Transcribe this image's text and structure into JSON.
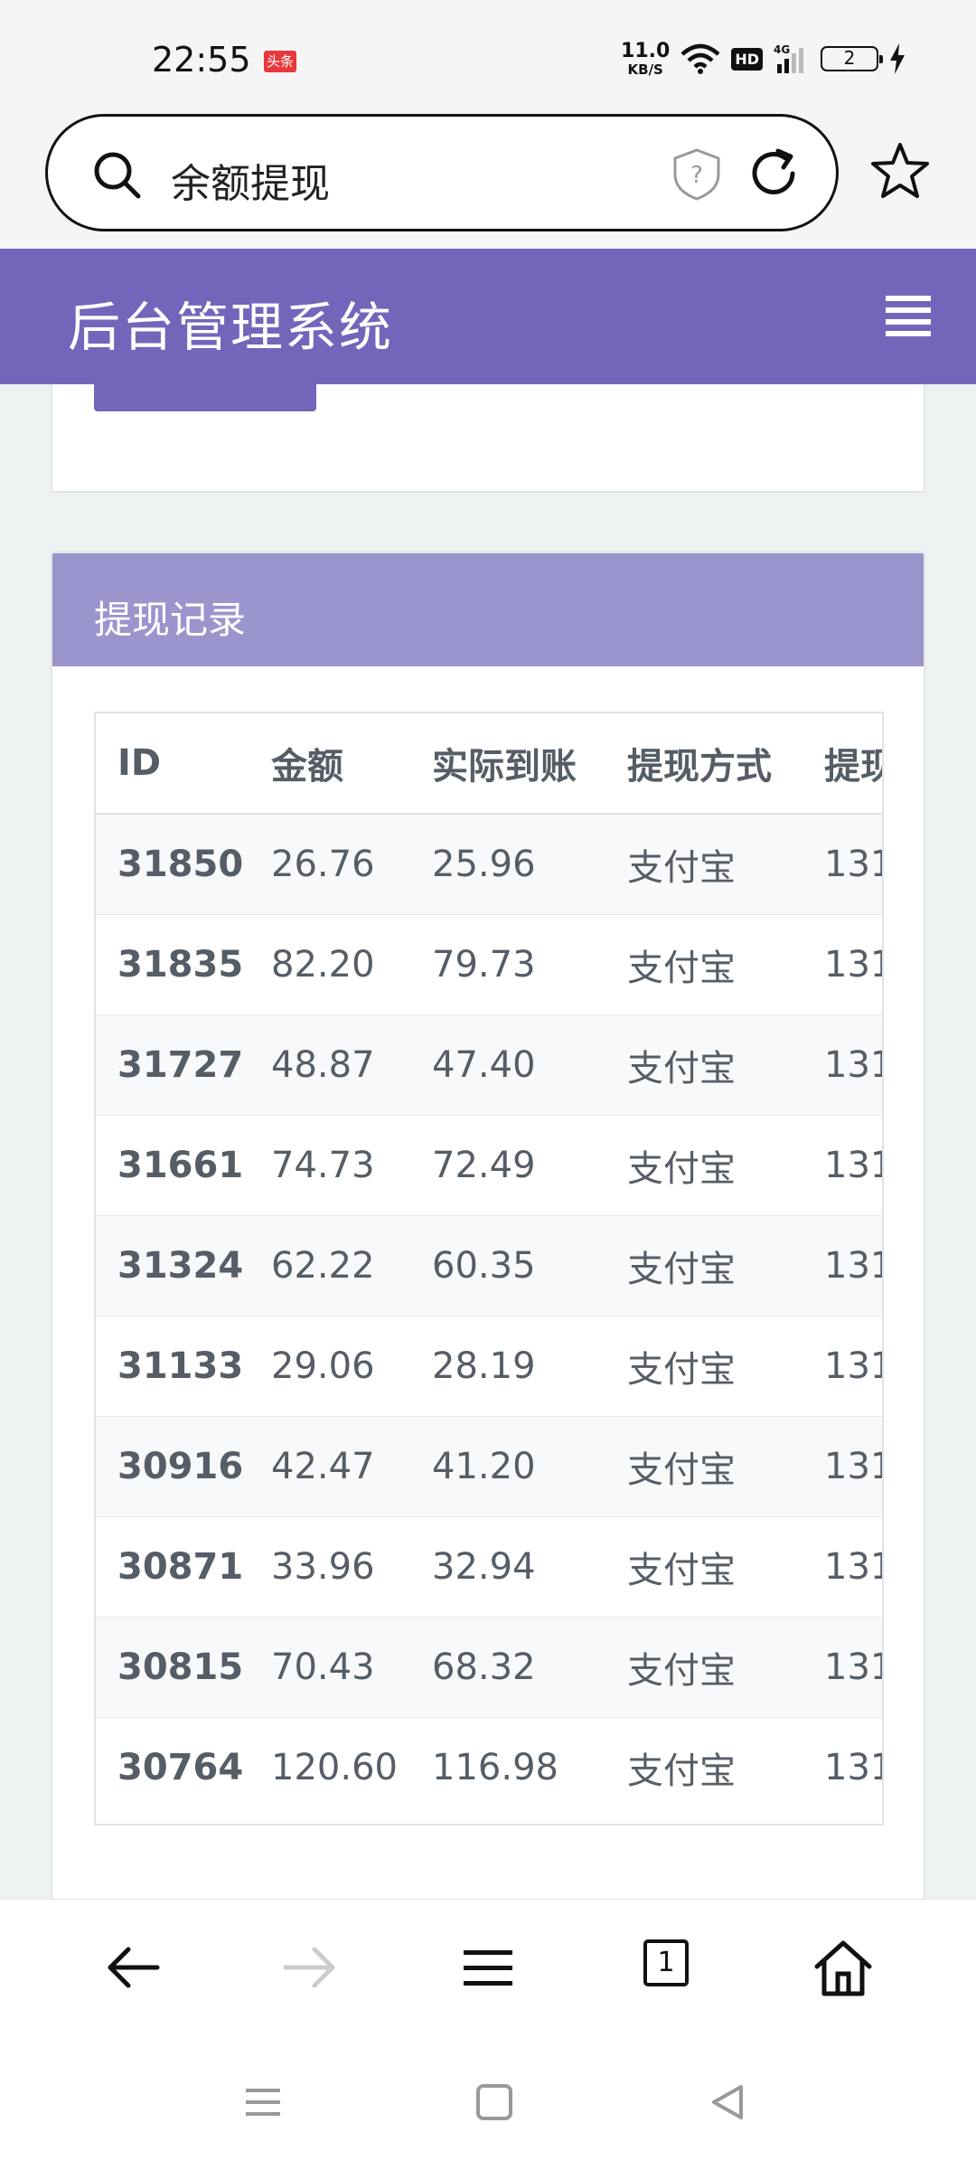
{
  "status_bar": {
    "time": "22:55",
    "app_badge": "头条",
    "net_speed_value": "11.0",
    "net_speed_unit": "KB/S",
    "hd_label": "HD",
    "signal_label": "4G",
    "battery": "2"
  },
  "browser": {
    "search_text": "余额提现",
    "icons": [
      "search-icon",
      "shield-icon",
      "reload-icon",
      "star-icon"
    ]
  },
  "app_header": {
    "title": "后台管理系统",
    "menu_icon": "hamburger-menu-icon"
  },
  "withdraw_card": {
    "title": "提现记录",
    "columns": [
      "ID",
      "金额",
      "实际到账",
      "提现方式",
      "提现"
    ],
    "rows": [
      {
        "id": "31850",
        "amount": "26.76",
        "actual": "25.96",
        "method": "支付宝",
        "account": "131"
      },
      {
        "id": "31835",
        "amount": "82.20",
        "actual": "79.73",
        "method": "支付宝",
        "account": "131"
      },
      {
        "id": "31727",
        "amount": "48.87",
        "actual": "47.40",
        "method": "支付宝",
        "account": "131"
      },
      {
        "id": "31661",
        "amount": "74.73",
        "actual": "72.49",
        "method": "支付宝",
        "account": "131"
      },
      {
        "id": "31324",
        "amount": "62.22",
        "actual": "60.35",
        "method": "支付宝",
        "account": "131"
      },
      {
        "id": "31133",
        "amount": "29.06",
        "actual": "28.19",
        "method": "支付宝",
        "account": "131"
      },
      {
        "id": "30916",
        "amount": "42.47",
        "actual": "41.20",
        "method": "支付宝",
        "account": "131"
      },
      {
        "id": "30871",
        "amount": "33.96",
        "actual": "32.94",
        "method": "支付宝",
        "account": "131"
      },
      {
        "id": "30815",
        "amount": "70.43",
        "actual": "68.32",
        "method": "支付宝",
        "account": "131"
      },
      {
        "id": "30764",
        "amount": "120.60",
        "actual": "116.98",
        "method": "支付宝",
        "account": "131"
      }
    ]
  },
  "bottom_nav": {
    "tab_count": "1",
    "icons": [
      "back-arrow-icon",
      "forward-arrow-icon",
      "menu-icon",
      "tabs-icon",
      "home-icon"
    ]
  },
  "system_nav": {
    "icons": [
      "recents-icon",
      "home-square-icon",
      "back-triangle-icon"
    ]
  },
  "colors": {
    "header": "#7266bb",
    "card_header": "#9a95cd",
    "text": "#555d66",
    "row_stripe": "#f7f9fb"
  }
}
